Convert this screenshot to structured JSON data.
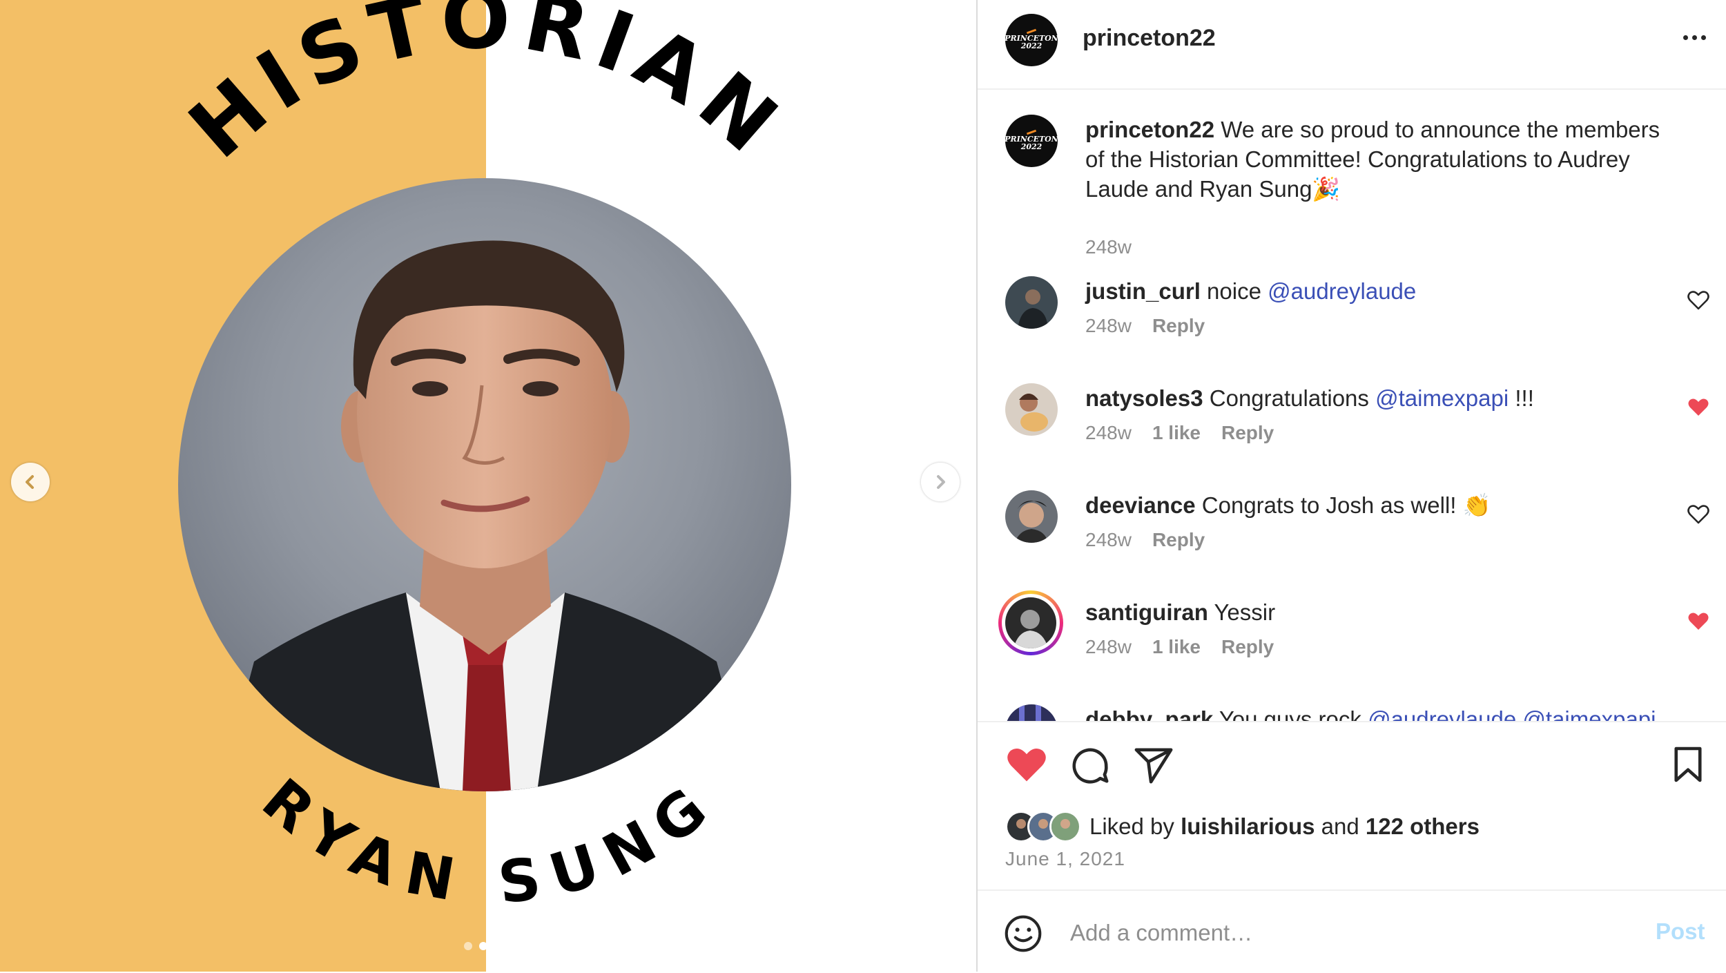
{
  "media": {
    "role_text": "HISTORIAN",
    "name_text": "RYAN SUNG",
    "bg_left_color": "#f3bf66",
    "bg_right_color": "#ffffff",
    "slide_count": 2,
    "active_slide": 2,
    "prev_icon": "chevron-left-icon",
    "next_icon": "chevron-right-icon"
  },
  "header": {
    "username": "princeton22",
    "logo_text_line1": "PRINCETON",
    "logo_text_line2": "2022"
  },
  "caption": {
    "username": "princeton22",
    "text": "We are so proud to announce the members of the Historian Committee! Congratulations to Audrey Laude and Ryan Sung🎉",
    "time": "248w"
  },
  "comments": [
    {
      "username": "justin_curl",
      "text": "noice ",
      "mention": "@audreylaude",
      "suffix": "",
      "time": "248w",
      "likes": "",
      "reply": "Reply",
      "liked": false
    },
    {
      "username": "natysoles3",
      "text": "Congratulations ",
      "mention": "@taimexpapi",
      "suffix": " !!!",
      "time": "248w",
      "likes": "1 like",
      "reply": "Reply",
      "liked": true
    },
    {
      "username": "deeviance",
      "text": "Congrats to Josh as well! 👏",
      "mention": "",
      "suffix": "",
      "time": "248w",
      "likes": "",
      "reply": "Reply",
      "liked": false
    },
    {
      "username": "santiguiran",
      "text": "Yessir",
      "mention": "",
      "suffix": "",
      "time": "248w",
      "likes": "1 like",
      "reply": "Reply",
      "liked": true
    },
    {
      "username": "debby_park",
      "text": "You guys rock ",
      "mention": "@audreylaude @taimexpapi",
      "suffix": "",
      "time": "",
      "likes": "",
      "reply": "",
      "liked": false
    }
  ],
  "actions": {
    "like_icon": "heart-filled-icon",
    "comment_icon": "comment-bubble-icon",
    "share_icon": "paper-plane-icon",
    "save_icon": "bookmark-icon",
    "liked_by_prefix": "Liked by ",
    "liked_by_user": "luishilarious",
    "liked_by_and": " and ",
    "liked_by_others": "122 others",
    "date": "June 1, 2021"
  },
  "comment_bar": {
    "emoji_icon": "smiley-icon",
    "placeholder": "Add a comment…",
    "post_label": "Post"
  },
  "colors": {
    "like_red": "#ed4956",
    "mention_blue": "#3a4fb6",
    "post_disabled": "#b2dffc"
  }
}
